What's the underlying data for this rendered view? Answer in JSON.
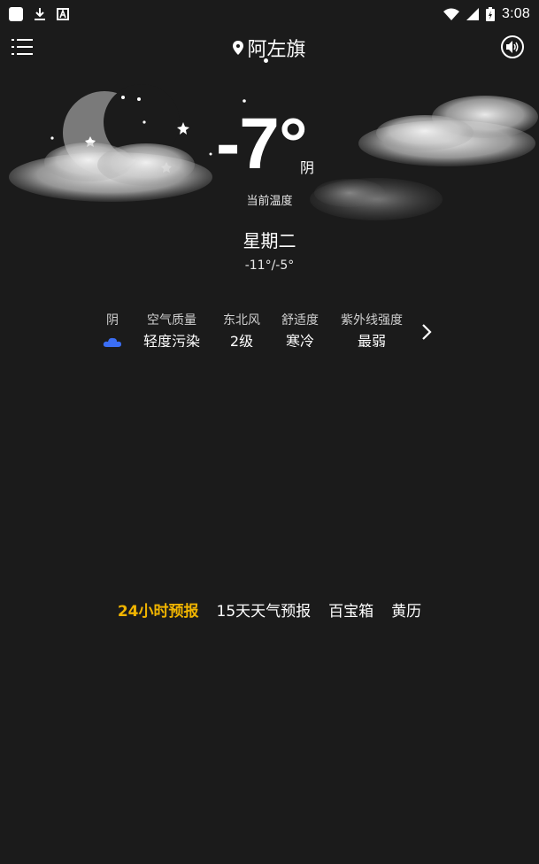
{
  "status_bar": {
    "time": "3:08"
  },
  "header": {
    "location": "阿左旗"
  },
  "weather": {
    "temperature": "-7°",
    "condition": "阴",
    "temperature_caption": "当前温度",
    "weekday": "星期二",
    "range": "-11°/-5°"
  },
  "stats": [
    {
      "label": "阴",
      "value": "",
      "icon": "cloud-icon"
    },
    {
      "label": "空气质量",
      "value": "轻度污染"
    },
    {
      "label": "东北风",
      "value": "2级"
    },
    {
      "label": "舒适度",
      "value": "寒冷"
    },
    {
      "label": "紫外线强度",
      "value": "最弱"
    }
  ],
  "tabs": [
    {
      "label": "24小时预报",
      "active": true
    },
    {
      "label": "15天天气预报",
      "active": false
    },
    {
      "label": "百宝箱",
      "active": false
    },
    {
      "label": "黄历",
      "active": false
    }
  ],
  "colors": {
    "background": "#1b1b1b",
    "active_tab": "#f0b400",
    "cloud_icon": "#3b6ef5"
  }
}
